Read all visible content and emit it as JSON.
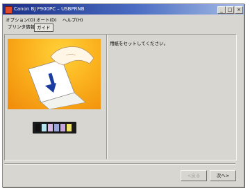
{
  "window": {
    "title": "Canon BJ F900PC – USBPRNB",
    "controls": {
      "minimize": "_",
      "maximize": "□",
      "close": "×"
    }
  },
  "menu": [
    {
      "label": "オプション(O)"
    },
    {
      "label": "オート(D)"
    },
    {
      "label": "ヘルプ(H)"
    }
  ],
  "tabs": [
    {
      "label": "プリンタ情報",
      "active": false
    },
    {
      "label": "ガイド",
      "active": true
    }
  ],
  "illustration": {
    "icon": "paper-insert-arrow-icon",
    "background_color": "#f8a81a"
  },
  "ink_tanks": [
    {
      "color": "#111111"
    },
    {
      "color": "#b8e4f0"
    },
    {
      "color": "#d7b6e6"
    },
    {
      "color": "#9aa6d8"
    },
    {
      "color": "#c7a6e0"
    },
    {
      "color": "#f0e46a"
    }
  ],
  "message": "用紙をセットしてください。",
  "buttons": {
    "back_label": "<戻る",
    "next_label": "次へ>"
  }
}
